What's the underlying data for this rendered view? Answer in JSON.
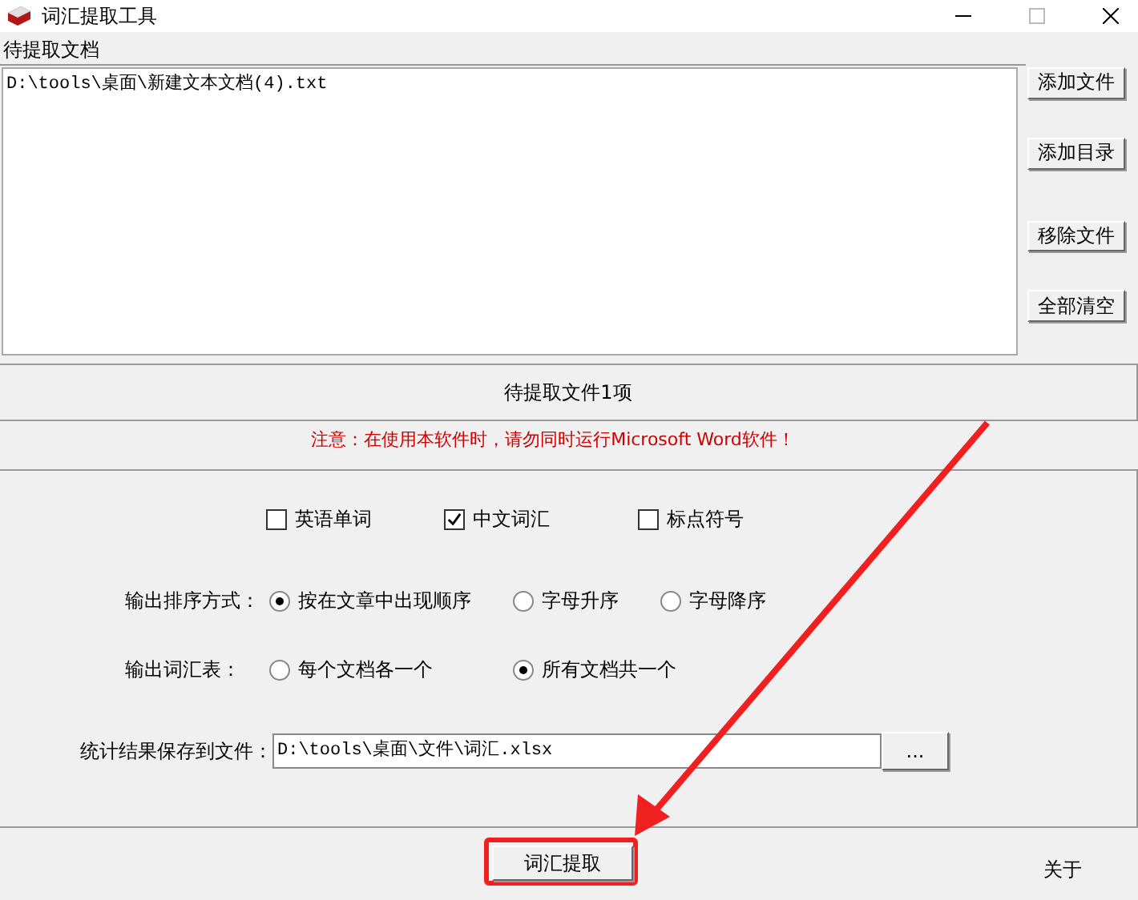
{
  "window": {
    "title": "词汇提取工具"
  },
  "documents": {
    "label": "待提取文档",
    "files": [
      "D:\\tools\\桌面\\新建文本文档(4).txt"
    ]
  },
  "file_buttons": [
    "添加文件",
    "添加目录",
    "移除文件",
    "全部清空"
  ],
  "status": "待提取文件1项",
  "warning": "注意：在使用本软件时，请勿同时运行Microsoft Word软件！",
  "checkboxes": [
    {
      "label": "英语单词",
      "checked": false
    },
    {
      "label": "中文词汇",
      "checked": true
    },
    {
      "label": "标点符号",
      "checked": false
    }
  ],
  "radio_groups": [
    {
      "label": "输出排序方式：",
      "options": [
        {
          "label": "按在文章中出现顺序",
          "selected": true
        },
        {
          "label": "字母升序",
          "selected": false
        },
        {
          "label": "字母降序",
          "selected": false
        }
      ]
    },
    {
      "label": "输出词汇表：",
      "options": [
        {
          "label": "每个文档各一个",
          "selected": false
        },
        {
          "label": "所有文档共一个",
          "selected": true
        }
      ]
    }
  ],
  "save": {
    "label": "统计结果保存到文件：",
    "value": "D:\\tools\\桌面\\文件\\词汇.xlsx",
    "browse": "..."
  },
  "extract_button": "词汇提取",
  "about_link": "关于"
}
